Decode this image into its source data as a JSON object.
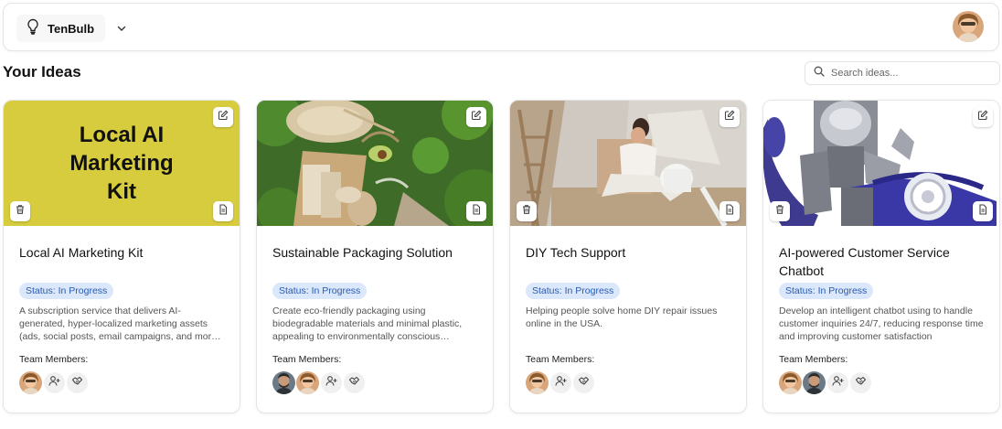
{
  "app": {
    "name": "TenBulb"
  },
  "page": {
    "title": "Your Ideas"
  },
  "search": {
    "placeholder": "Search ideas..."
  },
  "team_label": "Team Members:",
  "cards": [
    {
      "title": "Local AI Marketing Kit",
      "image_text": "Local AI Marketing Kit",
      "image_bg": "#d6cc3e",
      "status": "Status: In Progress",
      "description": "A subscription service that delivers AI-generated, hyper-localized marketing assets (ads, social posts, email campaigns, and more) for small local businesses."
    },
    {
      "title": "Sustainable Packaging Solution",
      "status": "Status: In Progress",
      "description": "Create eco-friendly packaging using biodegradable materials and minimal plastic, appealing to environmentally conscious consumers."
    },
    {
      "title": "DIY Tech Support",
      "status": "Status: In Progress",
      "description": "Helping people solve home DIY repair issues online in the USA."
    },
    {
      "title": "AI-powered Customer Service Chatbot",
      "status": "Status: In Progress",
      "description": "Develop an intelligent chatbot using to handle customer inquiries 24/7, reducing response time and improving customer satisfaction"
    }
  ],
  "colors": {
    "badge_bg": "#dbe8fb",
    "badge_text": "#2a5bb0",
    "border": "#e5e5e5"
  },
  "icons": [
    "lightbulb-icon",
    "chevron-down-icon",
    "search-icon",
    "edit-icon",
    "trash-icon",
    "document-icon",
    "add-user-icon",
    "handshake-icon"
  ]
}
